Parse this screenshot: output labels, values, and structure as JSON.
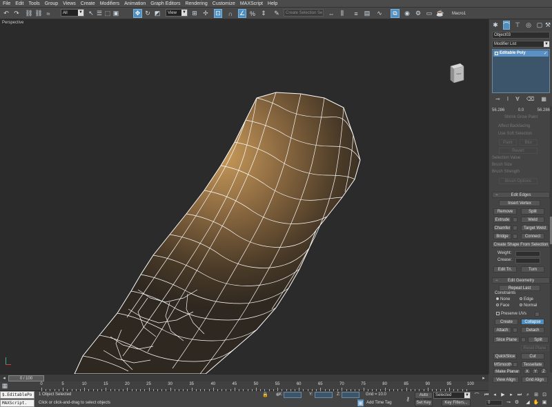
{
  "menu": [
    "File",
    "Edit",
    "Tools",
    "Group",
    "Views",
    "Create",
    "Modifiers",
    "Animation",
    "Graph Editors",
    "Rendering",
    "Customize",
    "MAXScript",
    "Help"
  ],
  "toolbar": {
    "filter_value": "All",
    "refcoord_value": "View",
    "selection_set_placeholder": "Create Selection Se",
    "macro_label": "Macro1"
  },
  "viewport": {
    "label": "Perspective",
    "viewcube_face": "LEFT"
  },
  "command_panel": {
    "object_name": "Object03",
    "modifier_list": "Modifier List",
    "stack_item": "Editable Poly",
    "soft_sel_values": [
      "56.286",
      "0.0",
      "56.286"
    ],
    "dim_rows": [
      "Shrink  Grow  Paint",
      "Affect Backfacing",
      "Use Soft Selection"
    ],
    "dim_buttons": [
      "Paint",
      "Blur",
      "Revert"
    ],
    "dim_labels": [
      "Selection Value",
      "Brush Size",
      "Brush Strength",
      "Brush Options"
    ],
    "edit_edges": {
      "title": "Edit Edges",
      "insert_vertex": "Insert Vertex",
      "remove": "Remove",
      "split": "Split",
      "extrude": "Extrude",
      "weld": "Weld",
      "chamfer": "Chamfer",
      "target_weld": "Target Weld",
      "bridge": "Bridge",
      "connect": "Connect",
      "create_shape": "Create Shape From Selection",
      "weight_label": "Weight:",
      "crease_label": "Crease:",
      "edit_tri": "Edit Tri.",
      "turn": "Turn"
    },
    "edit_geometry": {
      "title": "Edit Geometry",
      "repeat_last": "Repeat Last",
      "constraints_label": "Constraints",
      "none": "None",
      "edge": "Edge",
      "face": "Face",
      "normal": "Normal",
      "preserve_uvs": "Preserve UVs",
      "create": "Create",
      "collapse": "Collapse",
      "attach": "Attach",
      "detach": "Detach",
      "slice_plane": "Slice Plane",
      "split": "Split",
      "reset_plane": "Reset Plane",
      "quickslice": "QuickSlice",
      "cut": "Cut",
      "msmooth": "MSmooth",
      "tessellate": "Tessellate",
      "make_planar": "Make Planar",
      "x": "X",
      "y": "Y",
      "z": "Z",
      "view_align": "View Align",
      "grid_align": "Grid Align"
    }
  },
  "timeline": {
    "slider_text": "0 / 100",
    "ticks": [
      "0",
      "5",
      "10",
      "15",
      "20",
      "25",
      "30",
      "35",
      "40",
      "45",
      "50",
      "55",
      "60",
      "65",
      "70",
      "75",
      "80",
      "85",
      "90",
      "95",
      "100"
    ]
  },
  "status": {
    "maxscript_1": "$.EditablePo",
    "maxscript_2": "MAXScript.",
    "selected_text": "1 Object Selected",
    "prompt_text": "Click or click-and-drag to select objects",
    "x_label": "X:",
    "y_label": "Y:",
    "z_label": "Z:",
    "grid_text": "Grid = 10.0",
    "add_time_tag": "Add Time Tag",
    "auto_key": "Auto Key",
    "set_key": "Set Key",
    "selected_value": "Selected",
    "key_filters": "Key Filters...",
    "frame_value": "0"
  },
  "colors": {
    "accent": "#4f8fc0",
    "background": "#2b2b2b",
    "wire": "#ffffff"
  }
}
